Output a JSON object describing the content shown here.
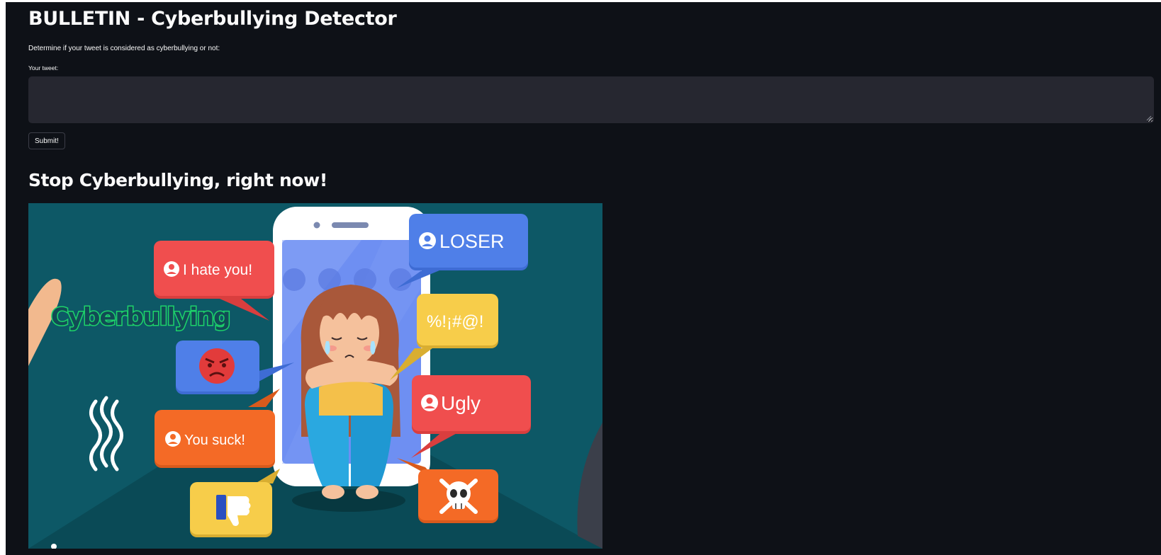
{
  "app": {
    "title": "BULLETIN - Cyberbullying Detector",
    "description": "Determine if your tweet is considered as cyberbullying or not:"
  },
  "form": {
    "tweet_label": "Your tweet:",
    "tweet_value": "",
    "submit_label": "Submit!"
  },
  "section": {
    "heading": "Stop Cyberbullying, right now!"
  },
  "illustration": {
    "headline": "Cyberbullying",
    "bubbles": {
      "hate": "I hate you!",
      "loser": "LOSER",
      "symbols": "%!¡#@!",
      "ugly": "Ugly",
      "suck": "You suck!"
    },
    "icons": [
      "user-icon",
      "angry-face-icon",
      "thumbs-down-icon",
      "skull-crossbones-icon",
      "wavy-lines-icon"
    ]
  },
  "colors": {
    "background": "#0e1117",
    "input_bg": "#262730",
    "text": "#fafafa",
    "hero_bg": "#0d5866",
    "bubble_red": "#f04e4e",
    "bubble_blue": "#4f7fe8",
    "bubble_yellow": "#f7cd4a",
    "bubble_orange": "#f46a26"
  }
}
